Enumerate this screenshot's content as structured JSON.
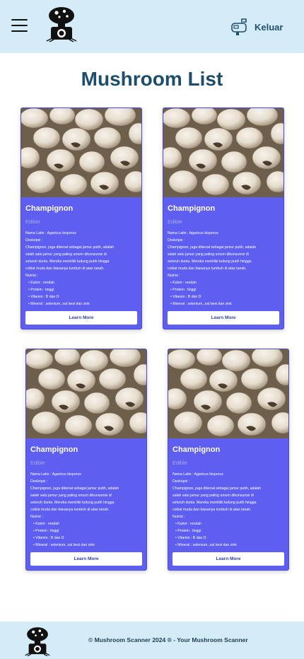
{
  "header": {
    "logout_label": "Keluar"
  },
  "page_title": "Mushroom List",
  "cards": [
    {
      "title": "Champignon",
      "status": "Edible",
      "latin": "Nama Latin : Agaricus bisporus",
      "desc_label": "Deskripsi :",
      "desc_1": "Champignon, juga dikenal sebagai jamur putih, adalah",
      "desc_2": "salah satu jamur yang paling umum dikonsumsi di",
      "desc_3": "seluruh dunia. Mereka memiliki tudung putih hingga",
      "desc_4": "coklat muda dan biasanya tumbuh di atas tanah.",
      "nutri_label": "Nutrisi :",
      "nutri": [
        "Kalori : rendah",
        "Protein : tinggi",
        "Vitamin : B dan D",
        "Mineral : selenium, zat besi dan zink"
      ],
      "button": "Learn More"
    },
    {
      "title": "Champignon",
      "status": "Edible",
      "latin": "Nama Latin : Agaricus bisporus",
      "desc_label": "Deskripsi :",
      "desc_1": "Champignon, juga dikenal sebagai jamur putih, adalah",
      "desc_2": "salah satu jamur yang paling umum dikonsumsi di",
      "desc_3": "seluruh dunia. Mereka memiliki tudung putih hingga",
      "desc_4": "coklat muda dan biasanya tumbuh di atas tanah.",
      "nutri_label": "Nutrisi :",
      "nutri": [
        "Kalori : rendah",
        "Protein : tinggi",
        "Vitamin : B dan D",
        "Mineral : selenium, zat besi dan zink"
      ],
      "button": "Learn More"
    },
    {
      "title": "Champignon",
      "status": "Edible",
      "latin": "Nama Latin : Agaricus bisporus",
      "desc_label": "Deskripsi :",
      "desc_1": "Champignon, juga dikenal sebagai jamur putih, adalah",
      "desc_2": "salah satu jamur yang paling umum dikonsumsi di",
      "desc_3": "seluruh dunia. Mereka memiliki tudung putih hingga",
      "desc_4": "coklat muda dan biasanya tumbuh di atas tanah.",
      "nutri_label": "Nutrisi :",
      "nutri": [
        "Kalori : rendah",
        "Protein : tinggi",
        "Vitamin : B dan D",
        "Mineral : selenium, zat besi dan zink"
      ],
      "button": "Learn More"
    },
    {
      "title": "Champignon",
      "status": "Edible",
      "latin": "Nama Latin : Agaricus bisporus",
      "desc_label": "Deskripsi :",
      "desc_1": "Champignon, juga dikenal sebagai jamur putih, adalah",
      "desc_2": "salah satu jamur yang paling umum dikonsumsi di",
      "desc_3": "seluruh dunia. Mereka memiliki tudung putih hingga",
      "desc_4": "coklat muda dan biasanya tumbuh di atas tanah.",
      "nutri_label": "Nutrisi :",
      "nutri": [
        "Kalori : rendah",
        "Protein : tinggi",
        "Vitamin : B dan D",
        "Mineral : selenium, zat besi dan zink"
      ],
      "button": "Learn More"
    }
  ],
  "footer": {
    "copyright": "© Mushroom Scanner 2024 ® - Your Mushroom Scanner"
  },
  "colors": {
    "header_bg": "#d4ecf7",
    "card_bg": "#5e5ef0",
    "title": "#1e4d6b"
  },
  "icons": {
    "menu": "hamburger-menu-icon",
    "logo": "mushroom-camera-logo",
    "logout": "mailbox-icon"
  }
}
